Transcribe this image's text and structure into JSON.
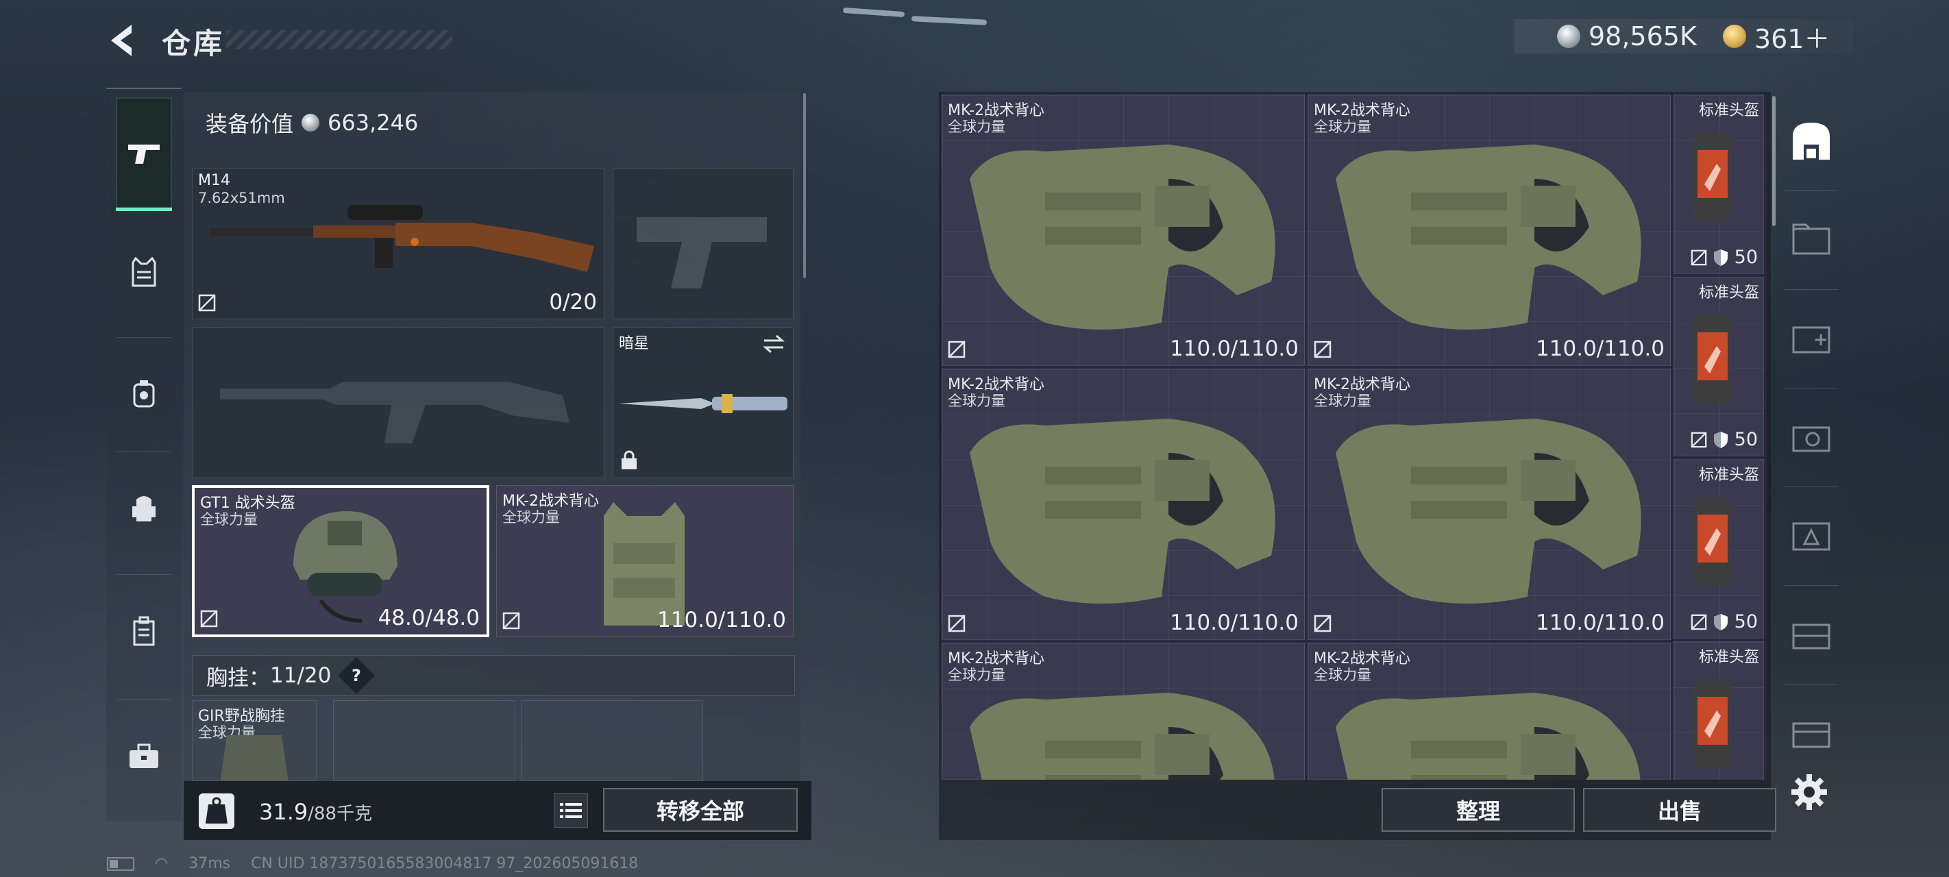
{
  "header": {
    "title": "仓库",
    "currency_silver": "98,565K",
    "currency_gold": "361＋"
  },
  "equipment": {
    "value_label": "装备价值",
    "value": "663,246",
    "primary_weapon": {
      "name": "M14",
      "caliber": "7.62x51mm",
      "ammo": "0/20"
    },
    "melee": {
      "name": "暗星"
    },
    "helmet": {
      "name": "GT1 战术头盔",
      "region": "全球力量",
      "durability": "48.0/48.0"
    },
    "vest": {
      "name": "MK-2战术背心",
      "region": "全球力量",
      "durability": "110.0/110.0"
    },
    "chest_rig": {
      "label": "胸挂：",
      "current": "11",
      "max": "/20",
      "help": "?"
    },
    "rig_item": {
      "name": "GIR野战胸挂",
      "region": "全球力量"
    }
  },
  "weight": {
    "current": "31.9",
    "max": "/88千克"
  },
  "buttons": {
    "transfer_all": "转移全部",
    "organize": "整理",
    "sell": "出售"
  },
  "storage": {
    "vests": [
      {
        "name": "MK-2战术背心",
        "region": "全球力量",
        "durability": "110.0/110.0"
      },
      {
        "name": "MK-2战术背心",
        "region": "全球力量",
        "durability": "110.0/110.0"
      },
      {
        "name": "MK-2战术背心",
        "region": "全球力量",
        "durability": "110.0/110.0"
      },
      {
        "name": "MK-2战术背心",
        "region": "全球力量",
        "durability": "110.0/110.0"
      },
      {
        "name": "MK-2战术背心",
        "region": "全球力量"
      },
      {
        "name": "MK-2战术背心",
        "region": "全球力量"
      }
    ],
    "helmets": [
      {
        "name": "标准头盔",
        "armor": "50"
      },
      {
        "name": "标准头盔",
        "armor": "50"
      },
      {
        "name": "标准头盔",
        "armor": "50"
      },
      {
        "name": "标准头盔"
      }
    ]
  },
  "status_bar": {
    "ping": "37ms",
    "uid": "CN UID 1873750165583004817 97_202605091618"
  },
  "icons": [
    "back-icon",
    "pistol-icon",
    "vest-icon",
    "backpack-icon",
    "pouch-icon",
    "case-icon",
    "toolbox-icon",
    "storage-icon",
    "settings-icon"
  ],
  "colors": {
    "accent": "#6af0c8",
    "cell_bg": "#3a394f"
  }
}
